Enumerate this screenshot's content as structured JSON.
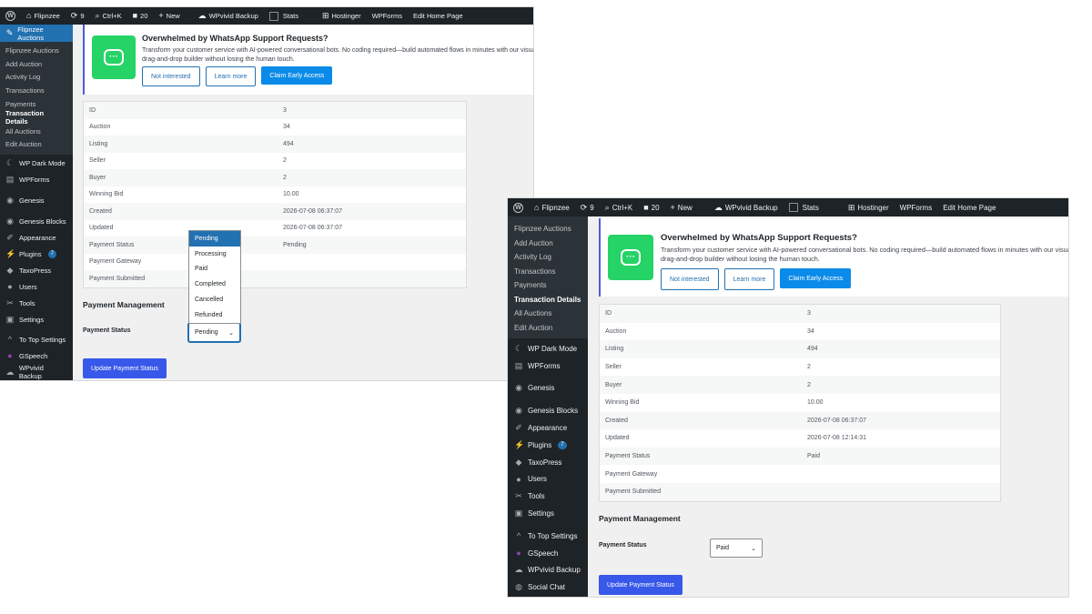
{
  "admin_bar": {
    "site": "Flipnzee",
    "updates_count": "9",
    "search_shortcut": "Ctrl+K",
    "comments_count": "20",
    "new_label": "New",
    "backup": "WPvivid Backup",
    "stats": "Stats",
    "hostinger": "Hostinger",
    "wpforms": "WPForms",
    "edit_home": "Edit Home Page"
  },
  "sidebar": {
    "current_menu": "Flipnzee Auctions",
    "submenu": [
      "Flipnzee Auctions",
      "Add Auction",
      "Activity Log",
      "Transactions",
      "Payments",
      "Transaction Details",
      "All Auctions",
      "Edit Auction"
    ],
    "menu": [
      {
        "label": "WP Dark Mode",
        "icon": "moon-icon"
      },
      {
        "label": "WPForms",
        "icon": "form-icon"
      },
      {
        "label": "Genesis",
        "icon": "genesis-icon"
      },
      {
        "label": "Genesis Blocks",
        "icon": "genesis-blocks-icon"
      },
      {
        "label": "Appearance",
        "icon": "brush-icon"
      },
      {
        "label": "Plugins",
        "icon": "plug-icon",
        "badge": "7"
      },
      {
        "label": "TaxoPress",
        "icon": "tag-icon"
      },
      {
        "label": "Users",
        "icon": "user-icon"
      },
      {
        "label": "Tools",
        "icon": "wrench-icon"
      },
      {
        "label": "Settings",
        "icon": "settings-icon"
      },
      {
        "label": "To Top Settings",
        "icon": "chevron-up-icon"
      },
      {
        "label": "GSpeech",
        "icon": "speech-icon"
      },
      {
        "label": "WPvivid Backup",
        "icon": "cloud-icon"
      },
      {
        "label": "Social Chat",
        "icon": "chat-icon"
      }
    ]
  },
  "notice": {
    "title": "Overwhelmed by WhatsApp Support Requests?",
    "description": "Transform your customer service with AI-powered conversational bots. No coding required—build automated flows in minutes with our visual drag-and-drop builder without losing the human touch.",
    "btn_not_interested": "Not interested",
    "btn_learn_more": "Learn more",
    "btn_claim": "Claim Early Access"
  },
  "labels": {
    "id": "ID",
    "auction": "Auction",
    "listing": "Listing",
    "seller": "Seller",
    "buyer": "Buyer",
    "winning_bid": "Winning Bid",
    "created": "Created",
    "updated": "Updated",
    "payment_status": "Payment Status",
    "payment_gateway": "Payment Gateway",
    "payment_submitted": "Payment Submitted"
  },
  "before": {
    "id": "3",
    "auction": "34",
    "listing": "494",
    "seller": "2",
    "buyer": "2",
    "winning_bid": "10.00",
    "created": "2026-07-08 06:37:07",
    "updated": "2026-07-08 06:37:07",
    "payment_status": "Pending",
    "payment_gateway": "",
    "payment_submitted": "",
    "select_value": "Pending"
  },
  "after": {
    "id": "3",
    "auction": "34",
    "listing": "494",
    "seller": "2",
    "buyer": "2",
    "winning_bid": "10.00",
    "created": "2026-07-08 06:37:07",
    "updated": "2026-07-08 12:14:31",
    "payment_status": "Paid",
    "payment_gateway": "",
    "payment_submitted": "",
    "select_value": "Paid"
  },
  "payment_management": {
    "title": "Payment Management",
    "status_label": "Payment Status",
    "update_button": "Update Payment Status",
    "options": [
      "Pending",
      "Processing",
      "Paid",
      "Completed",
      "Cancelled",
      "Refunded"
    ],
    "highlighted_option": "Pending"
  }
}
